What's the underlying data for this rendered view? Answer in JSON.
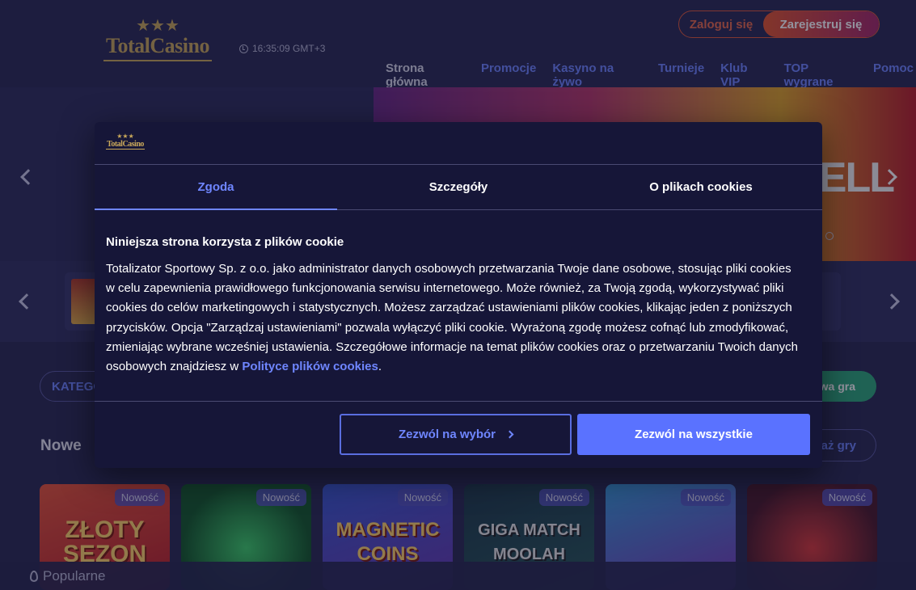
{
  "header": {
    "logo_text": "TotalCasino",
    "clock": "16:35:09 GMT+3",
    "login_label": "Zaloguj się",
    "register_label": "Zarejestruj się",
    "nav": [
      {
        "label": "Strona główna",
        "active": true
      },
      {
        "label": "Promocje"
      },
      {
        "label": "Kasyno na żywo"
      },
      {
        "label": "Turnieje"
      },
      {
        "label": "Klub VIP"
      },
      {
        "label": "TOP wygrane"
      },
      {
        "label": "Pomoc"
      }
    ]
  },
  "hero": {
    "banner_text": "DELL"
  },
  "filters": {
    "categories_label": "KATEGORIE",
    "random_label": "Losowa gra",
    "show_label": "Pokaż gry"
  },
  "games_section": {
    "title": "Nowe",
    "badge": "Nowość",
    "games": [
      {
        "title": "ZŁOTY SEZON"
      },
      {
        "title": ""
      },
      {
        "title": "MAGNETIC COINS"
      },
      {
        "title": "GIGA MATCH MOOLAH"
      },
      {
        "title": ""
      },
      {
        "title": ""
      }
    ]
  },
  "bottom_bar": {
    "label": "Popularne"
  },
  "cookie_dialog": {
    "logo_text": "TotalCasino",
    "tabs": [
      {
        "label": "Zgoda",
        "active": true
      },
      {
        "label": "Szczegóły"
      },
      {
        "label": "O plikach cookies"
      }
    ],
    "heading": "Niniejsza strona korzysta z plików cookie",
    "body": "Totalizator Sportowy Sp. z o.o. jako administrator danych osobowych przetwarzania Twoje dane osobowe, stosując pliki cookies w celu zapewnienia prawidłowego funkcjonowania serwisu internetowego. Może również, za Twoją zgodą, wykorzystywać pliki cookies do celów marketingowych i statystycznych. Możesz zarządzać ustawieniami plików cookies, klikając jeden z poniższych przycisków. Opcja \"Zarządzaj ustawieniami\" pozwala wyłączyć pliki cookie. Wyrażoną zgodę możesz cofnąć lub zmodyfikować, zmieniając wybrane wcześniej ustawienia.   Szczegółowe informacje na temat plików cookies oraz o przetwarzaniu Twoich danych osobowych znajdziesz w ",
    "link_text": "Polityce plików cookies",
    "body_end": ".",
    "btn_select": "Zezwól na wybór",
    "btn_all": "Zezwól na wszystkie"
  },
  "colors": {
    "accent": "#6f86ff",
    "register_start": "#e4572e",
    "register_end": "#a52a6a",
    "random_game": "#2fa87a"
  }
}
